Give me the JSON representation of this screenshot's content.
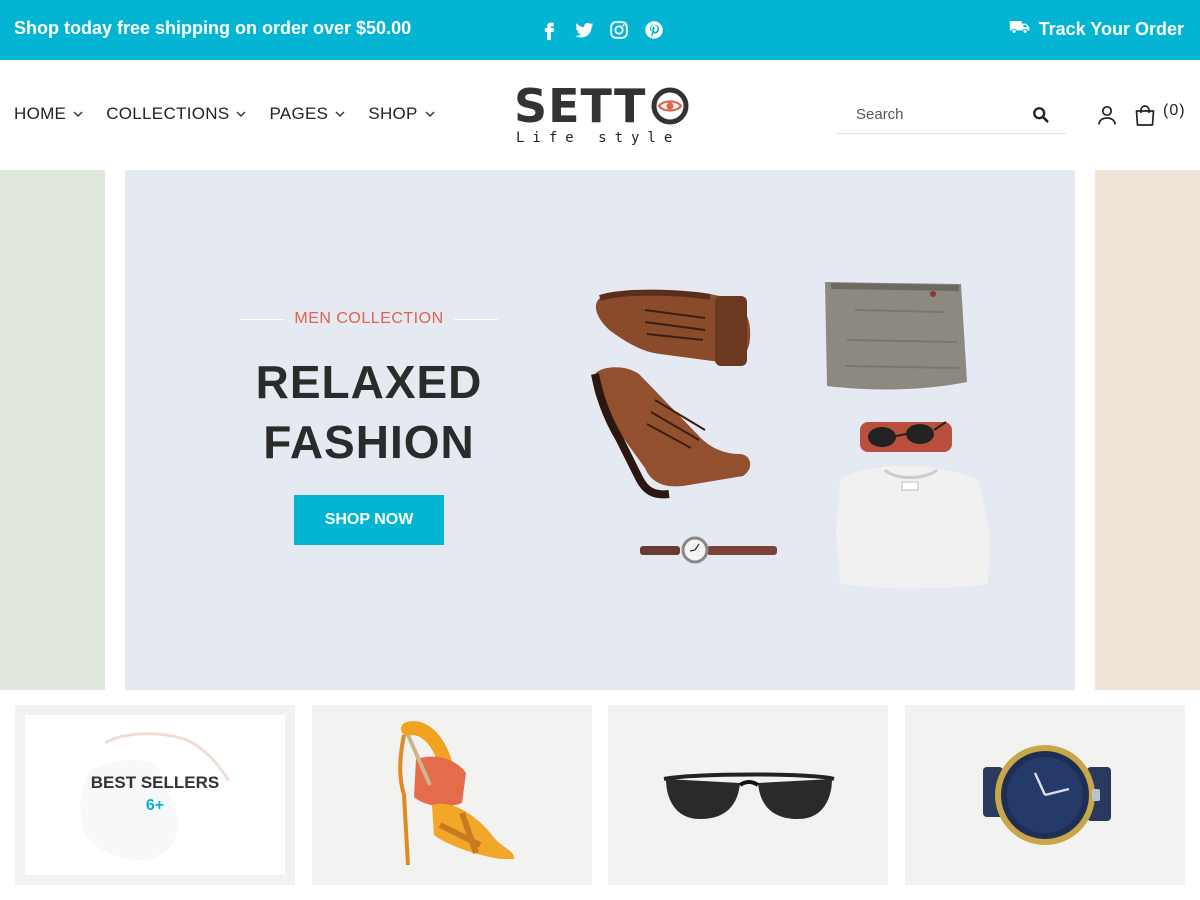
{
  "topbar": {
    "promo": "Shop today free shipping on order over $50.00",
    "socials": [
      "facebook-icon",
      "twitter-icon",
      "instagram-icon",
      "pinterest-icon"
    ],
    "track_label": "Track Your Order",
    "bg_color": "#03b4d3"
  },
  "nav": {
    "items": [
      {
        "label": "HOME"
      },
      {
        "label": "COLLECTIONS"
      },
      {
        "label": "PAGES"
      },
      {
        "label": "SHOP"
      }
    ]
  },
  "logo": {
    "word": "SETT",
    "tagline": "Life style"
  },
  "search": {
    "placeholder": "Search"
  },
  "cart": {
    "count": "(0)"
  },
  "hero": {
    "subtitle": "MEN COLLECTION",
    "title_line1": "RELAXED",
    "title_line2": "FASHION",
    "cta": "SHOP NOW",
    "accent_color": "#e0634e"
  },
  "tiles": [
    {
      "label": "BEST SELLERS",
      "count": "6+"
    }
  ]
}
